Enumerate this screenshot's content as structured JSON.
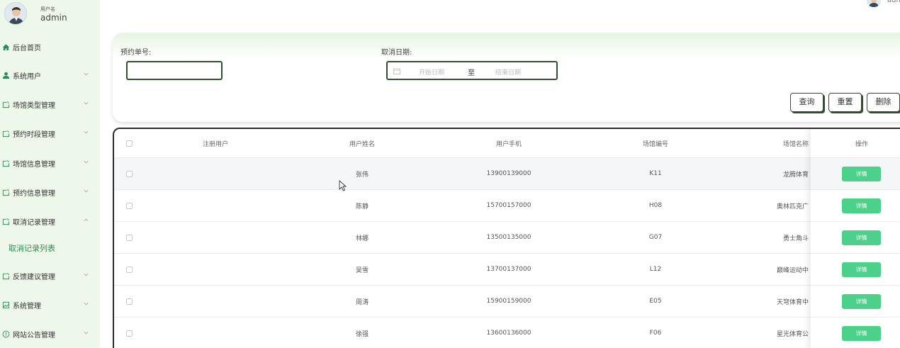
{
  "user": {
    "caption": "用户名",
    "name": "admin"
  },
  "top_right": {
    "text": "adm"
  },
  "sidebar": {
    "items": [
      {
        "label": "后台首页",
        "icon": "home-icon"
      },
      {
        "label": "系统用户",
        "icon": "user-icon"
      },
      {
        "label": "场馆类型管理",
        "icon": "folder-icon"
      },
      {
        "label": "预约时段管理",
        "icon": "folder-icon"
      },
      {
        "label": "场馆信息管理",
        "icon": "folder-icon"
      },
      {
        "label": "预约信息管理",
        "icon": "folder-icon"
      },
      {
        "label": "取消记录管理",
        "icon": "folder-icon"
      },
      {
        "label": "反馈建议管理",
        "icon": "folder-icon"
      },
      {
        "label": "系统管理",
        "icon": "image-icon"
      },
      {
        "label": "网站公告管理",
        "icon": "info-icon"
      }
    ],
    "submenu_active": "取消记录列表"
  },
  "search": {
    "order_label": "预约单号:",
    "date_label": "取消日期:",
    "start_placeholder": "开始日期",
    "separator": "至",
    "end_placeholder": "结束日期",
    "query_label": "查询",
    "reset_label": "重置",
    "delete_label": "删除"
  },
  "table": {
    "headers": [
      "注册用户",
      "用户姓名",
      "用户手机",
      "场馆编号",
      "场馆名称",
      "操作"
    ],
    "detail_label": "详情",
    "rows": [
      {
        "user": "",
        "name": "张伟",
        "phone": "13900139000",
        "code": "K11",
        "venue": "龙腾体育"
      },
      {
        "user": "",
        "name": "陈静",
        "phone": "15700157000",
        "code": "H08",
        "venue": "奥林匹克广"
      },
      {
        "user": "",
        "name": "林娜",
        "phone": "13500135000",
        "code": "G07",
        "venue": "勇士角斗"
      },
      {
        "user": "",
        "name": "吴雪",
        "phone": "13700137000",
        "code": "L12",
        "venue": "巅峰运动中"
      },
      {
        "user": "",
        "name": "周涛",
        "phone": "15900159000",
        "code": "E05",
        "venue": "天穹体育中"
      },
      {
        "user": "",
        "name": "徐强",
        "phone": "13600136000",
        "code": "F06",
        "venue": "星光体育公"
      }
    ]
  },
  "colors": {
    "accent": "#4cd18a",
    "sidebar_bg": "#eef8ea",
    "active_text": "#2e8b57"
  }
}
